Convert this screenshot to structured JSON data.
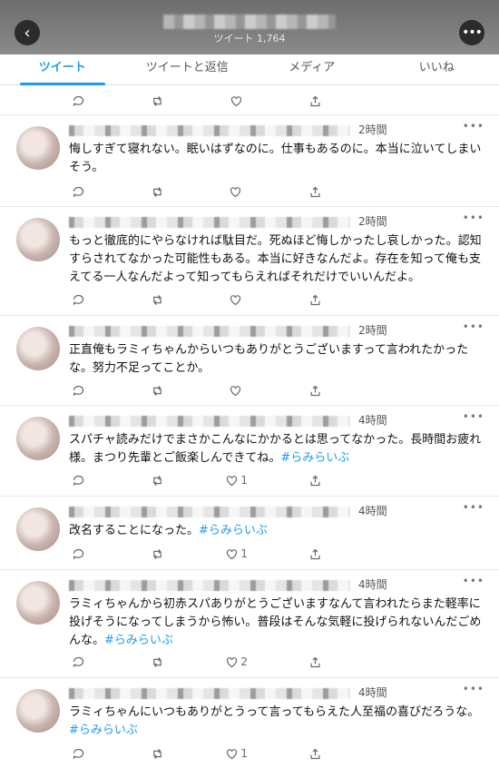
{
  "header": {
    "back_icon": "back-arrow-icon",
    "more_icon": "more-dots-icon",
    "tweet_count": "ツイート 1,764"
  },
  "tabs": [
    {
      "label": "ツイート"
    },
    {
      "label": "ツイートと返信"
    },
    {
      "label": "メディア"
    },
    {
      "label": "いいね"
    }
  ],
  "tweets": [
    {
      "time": "2時間",
      "text": "悔しすぎて寝れない。眠いはずなのに。仕事もあるのに。本当に泣いてしまいそう。",
      "likes": ""
    },
    {
      "time": "2時間",
      "text": "もっと徹底的にやらなければ駄目だ。死ぬほど悔しかったし哀しかった。認知すらされてなかった可能性もある。本当に好きなんだよ。存在を知って俺も支えてる一人なんだよって知ってもらえればそれだけでいいんだよ。",
      "likes": ""
    },
    {
      "time": "2時間",
      "text": "正直俺もラミィちゃんからいつもありがとうございますって言われたかったな。努力不足ってことか。",
      "likes": ""
    },
    {
      "time": "4時間",
      "text": "スパチャ読みだけでまさかこんなにかかるとは思ってなかった。長時間お疲れ様。まつり先輩とご飯楽しんできてね。",
      "hashtag": "#らみらいぶ",
      "likes": "1"
    },
    {
      "time": "4時間",
      "text": "改名することになった。",
      "hashtag": "#らみらいぶ",
      "likes": "1"
    },
    {
      "time": "4時間",
      "text": "ラミィちゃんから初赤スパありがとうございますなんて言われたらまた軽率に投げそうになってしまうから怖い。普段はそんな気軽に投げられないんだごめんな。",
      "hashtag": "#らみらいぶ",
      "likes": "2"
    },
    {
      "time": "4時間",
      "text": "ラミィちゃんにいつもありがとうって言ってもらえた人至福の喜びだろうな。",
      "hashtag": "#らみらいぶ",
      "likes": "1"
    }
  ],
  "colors": {
    "accent": "#1d9bf0",
    "text": "#111111",
    "muted": "#6b6b6b"
  }
}
